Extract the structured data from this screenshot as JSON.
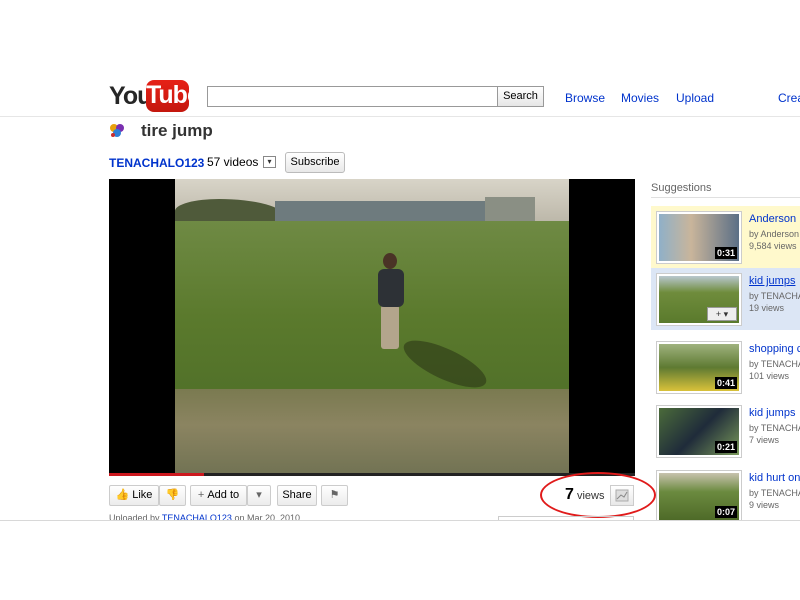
{
  "header": {
    "logo_you": "You",
    "logo_tube": "Tube",
    "search_placeholder": "",
    "search_button": "Search",
    "nav": [
      "Browse",
      "Movies",
      "Upload",
      "Crea"
    ]
  },
  "video": {
    "title": "tire jump",
    "channel": "TENACHALO123",
    "videos_count": "57 videos",
    "subscribe": "Subscribe",
    "progress": 0.18
  },
  "actions": {
    "like": "Like",
    "add_to": "Add to",
    "share": "Share",
    "uploaded_prefix": "Uploaded by",
    "uploaded_user": "TENACHALO123",
    "uploaded_date": "on Mar 20, 2010",
    "views_count": "7",
    "views_label": "views"
  },
  "suggestions": {
    "label": "Suggestions",
    "items": [
      {
        "title": "Anderson ",
        "by": "by Anderson",
        "views": "9,584 views",
        "duration": "0:31",
        "highlight": "#fff9cc"
      },
      {
        "title": "kid jumps ",
        "by": "by TENACHA",
        "views": "19 views",
        "duration": "",
        "highlight": "#dce6f5"
      },
      {
        "title": "shopping c",
        "by": "by TENACHA",
        "views": "101 views",
        "duration": "0:41",
        "highlight": ""
      },
      {
        "title": "kid jumps",
        "by": "by TENACHA",
        "views": "7 views",
        "duration": "0:21",
        "highlight": ""
      },
      {
        "title": "kid hurt on",
        "by": "by TENACHA",
        "views": "9 views",
        "duration": "0:07",
        "highlight": ""
      }
    ]
  },
  "colors": {
    "link": "#0033cc",
    "brand_red": "#e62117",
    "annotation_red": "#e01b1b"
  },
  "icons": [
    "thumbs-up-icon",
    "thumbs-down-icon",
    "plus-icon",
    "chevron-down-icon",
    "flag-icon",
    "stats-icon"
  ]
}
